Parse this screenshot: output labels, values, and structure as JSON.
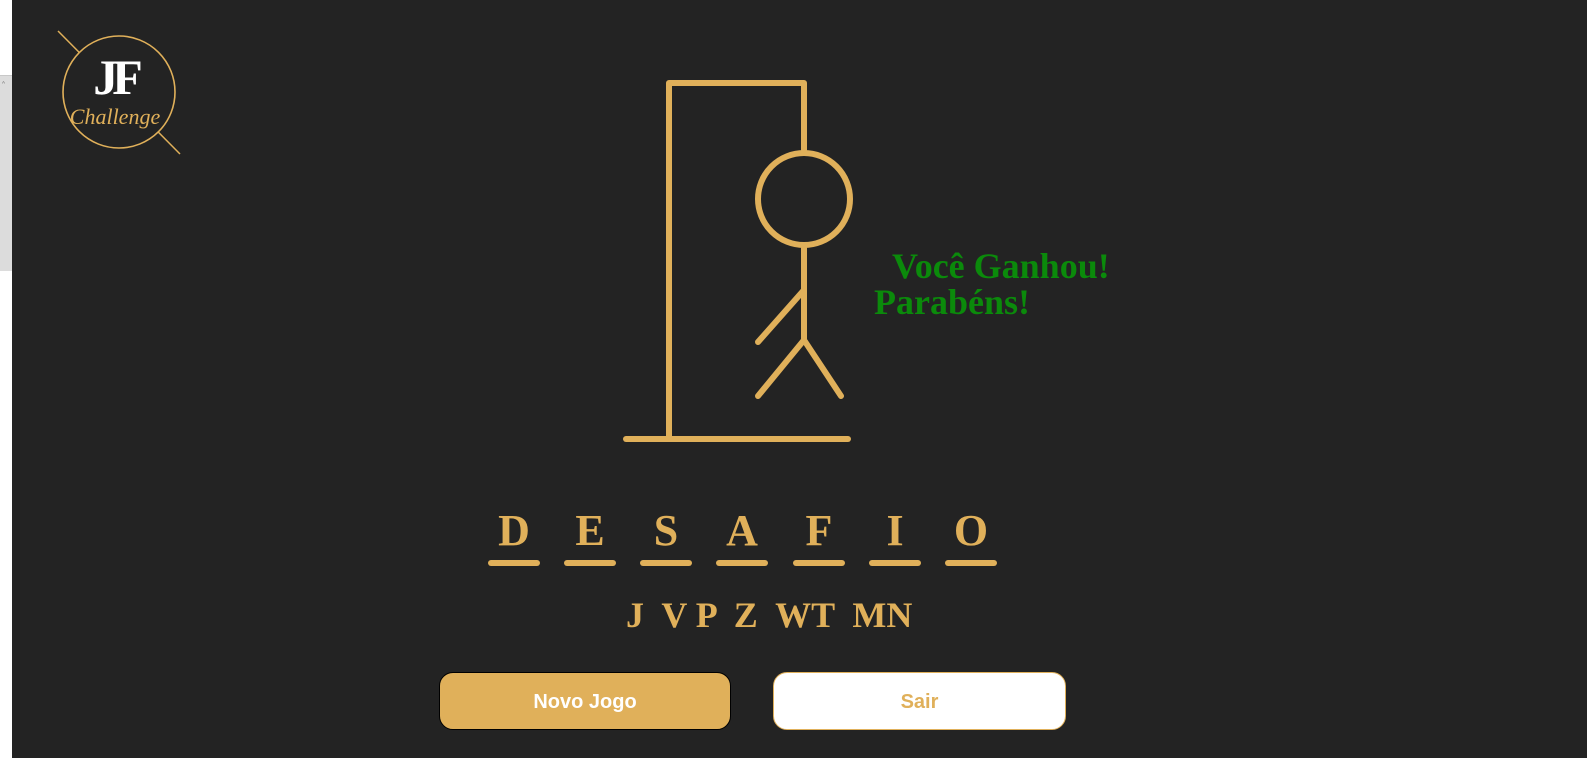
{
  "logo": {
    "brand": "JF",
    "subtitle": "Challenge"
  },
  "game": {
    "result_line1": "Você Ganhou!",
    "result_line2": "Parabéns!",
    "word_letters": [
      "D",
      "E",
      "S",
      "A",
      "F",
      "I",
      "O"
    ],
    "wrong_letters": "J  V P  Z  WT  MN"
  },
  "buttons": {
    "new_game": "Novo Jogo",
    "exit": "Sair"
  },
  "colors": {
    "background": "#232323",
    "accent": "#e0b05a",
    "success": "#0b8a0b",
    "button_text_light": "#ffffff"
  }
}
